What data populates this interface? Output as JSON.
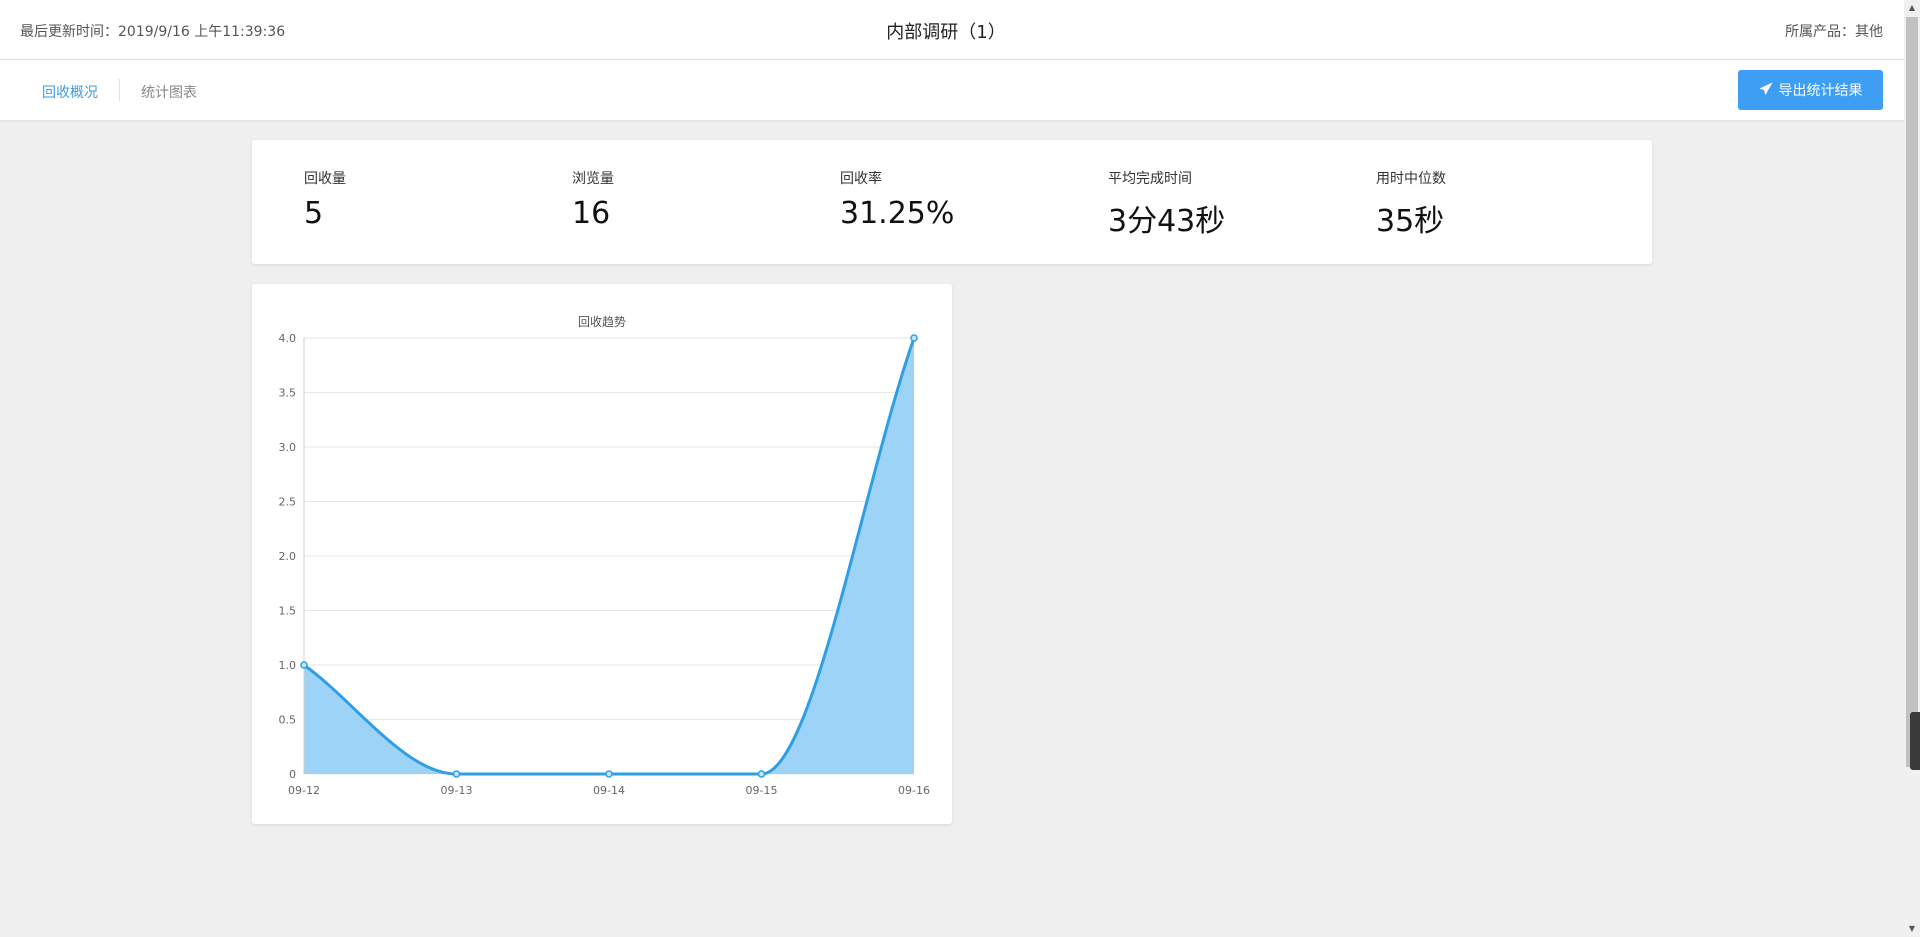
{
  "header": {
    "updated_label": "最后更新时间：2019/9/16 上午11:39:36",
    "title": "内部调研（1）",
    "product_label": "所属产品：其他"
  },
  "subnav": {
    "tab_overview": "回收概况",
    "tab_charts": "统计图表",
    "export_label": "导出统计结果",
    "export_icon": "paper-plane-icon"
  },
  "stats": [
    {
      "label": "回收量",
      "value": "5"
    },
    {
      "label": "浏览量",
      "value": "16"
    },
    {
      "label": "回收率",
      "value": "31.25%"
    },
    {
      "label": "平均完成时间",
      "value": "3分43秒"
    },
    {
      "label": "用时中位数",
      "value": "35秒"
    }
  ],
  "colors": {
    "accent": "#3a9ee8",
    "button": "#3e9ef4",
    "series_line": "#2e9fe6",
    "series_fill": "#9dd3f6"
  },
  "chart_data": {
    "type": "area",
    "title": "回收趋势",
    "categories": [
      "09-12",
      "09-13",
      "09-14",
      "09-15",
      "09-16"
    ],
    "series": [
      {
        "values": [
          1,
          0,
          0,
          0,
          4
        ]
      }
    ],
    "ylim": [
      0,
      4.0
    ],
    "yticks": [
      "0",
      "0.5",
      "1.0",
      "1.5",
      "2.0",
      "2.5",
      "3.0",
      "3.5",
      "4.0"
    ],
    "smooth": true,
    "grid": true
  }
}
